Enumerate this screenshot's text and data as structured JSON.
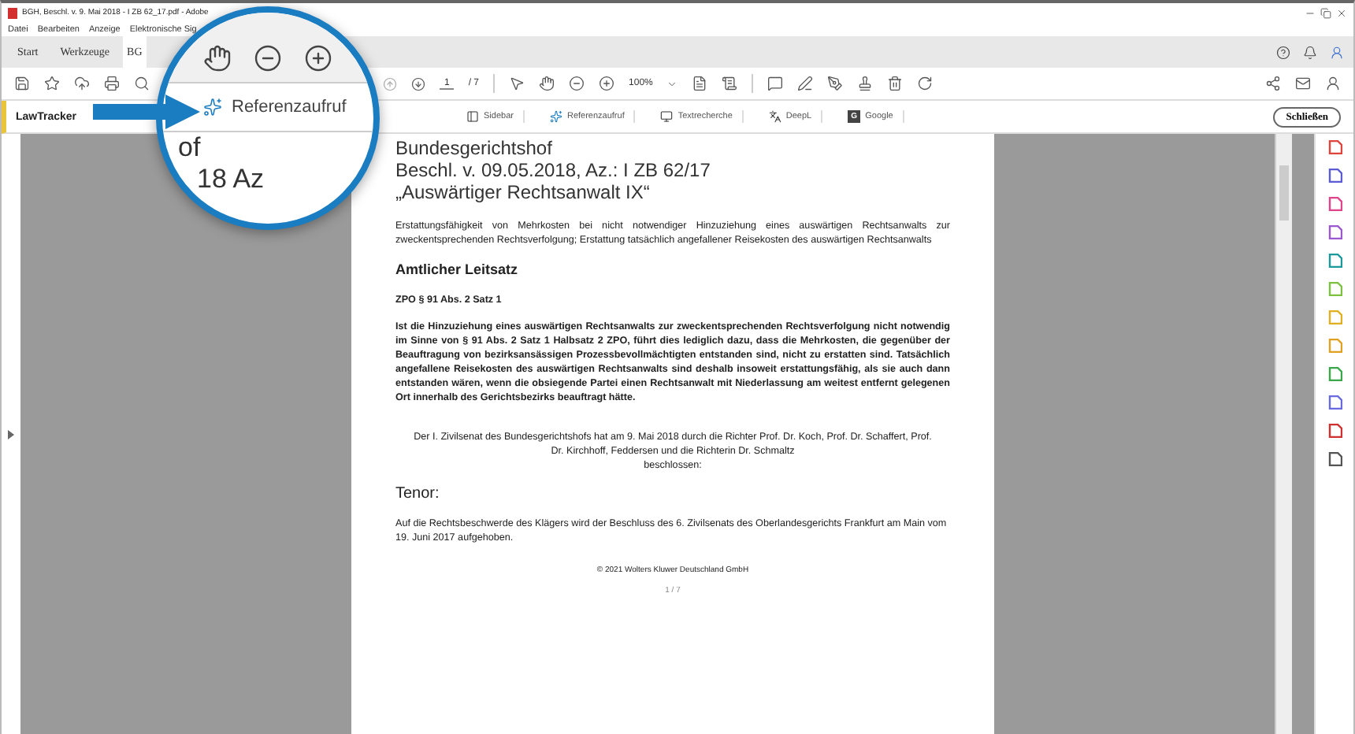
{
  "window": {
    "title": "BGH, Beschl. v. 9. Mai 2018 - I ZB 62_17.pdf - Adobe"
  },
  "menu": [
    "Datei",
    "Bearbeiten",
    "Anzeige",
    "Elektronische Sig"
  ],
  "tabs": [
    {
      "label": "Start",
      "selected": false
    },
    {
      "label": "Werkzeuge",
      "selected": false
    },
    {
      "label": "BG",
      "selected": true
    }
  ],
  "toolbar": {
    "page_current": "1",
    "page_total": "/ 7",
    "zoom": "100%"
  },
  "lawtracker": {
    "title": "LawTracker",
    "buttons": [
      {
        "kind": "sidebar",
        "label": "Sidebar"
      },
      {
        "kind": "reference",
        "label": "Referenzaufruf"
      },
      {
        "kind": "search",
        "label": "Textrecherche"
      },
      {
        "kind": "deepl",
        "label": "DeepL"
      },
      {
        "kind": "letter",
        "letter": "G",
        "label": "Google"
      }
    ],
    "close": "Schließen"
  },
  "document": {
    "court": "Bundesgerichtshof",
    "decision": "Beschl. v. 09.05.2018, Az.: I ZB 62/17",
    "title": "„Auswärtiger Rechtsanwalt IX“",
    "summary": "Erstattungsfähigkeit von Mehrkosten bei nicht notwendiger Hinzuziehung eines auswärtigen Rechtsanwalts zur zweckentsprechenden Rechtsverfolgung; Erstattung tatsächlich angefallener Reisekosten des auswärtigen Rechtsanwalts",
    "heading": "Amtlicher Leitsatz",
    "norm": "ZPO § 91 Abs. 2 Satz 1",
    "leitsatz": "Ist die Hinzuziehung eines auswärtigen Rechtsanwalts zur zweckentsprechenden Rechtsverfolgung nicht notwendig im Sinne von § 91 Abs. 2 Satz 1 Halbsatz 2 ZPO, führt dies lediglich dazu, dass die Mehrkosten, die gegenüber der Beauftragung von bezirksansässigen Prozessbevollmächtigten entstanden sind, nicht zu erstatten sind. Tatsächlich angefallene Reisekosten des auswärtigen Rechtsanwalts sind deshalb insoweit erstattungsfähig, als sie auch dann entstanden wären, wenn die obsiegende Partei einen Rechtsanwalt mit Niederlassung am weitest entfernt gelegenen Ort innerhalb des Gerichtsbezirks beauftragt hätte.",
    "preamble": "Der I. Zivilsenat des Bundesgerichtshofs hat am 9. Mai 2018 durch die Richter Prof. Dr. Koch, Prof. Dr. Schaffert, Prof. Dr. Kirchhoff, Feddersen und die Richterin Dr. Schmaltz",
    "resolved": "beschlossen:",
    "tenor_heading": "Tenor:",
    "tenor": "Auf die Rechtsbeschwerde des Klägers wird der Beschluss des 6. Zivilsenats des Oberlandesgerichts Frankfurt am Main vom 19. Juni 2017 aufgehoben.",
    "copyright": "© 2021 Wolters Kluwer Deutschland GmbH",
    "page_label": "1 / 7"
  },
  "magnifier": {
    "label": "Referenzaufruf",
    "fragment_1": "of",
    "fragment_2": "18 Az"
  }
}
